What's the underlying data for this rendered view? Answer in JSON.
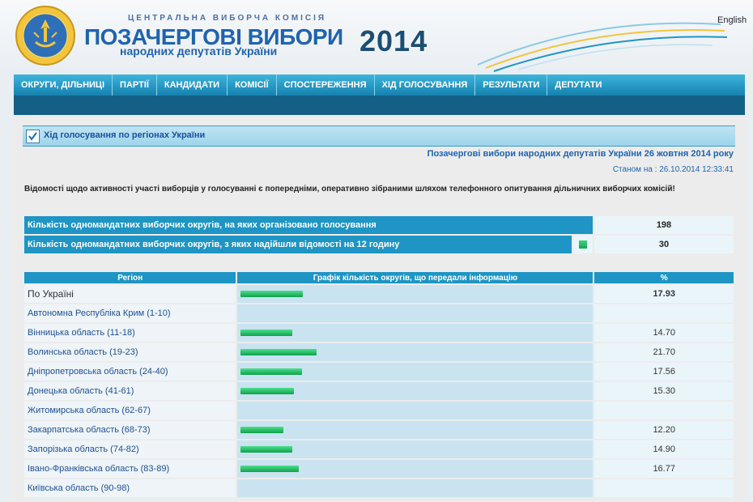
{
  "header": {
    "org": "ЦЕНТРАЛЬНА ВИБОРЧА КОМІСІЯ",
    "title_main": "ПОЗАЧЕРГОВІ ВИБОРИ",
    "title_sub": "народних депутатів України",
    "year": "2014",
    "lang_link": "English"
  },
  "nav": [
    "ОКРУГИ, ДІЛЬНИЦІ",
    "ПАРТІЇ",
    "КАНДИДАТИ",
    "КОМІСІЇ",
    "СПОСТЕРЕЖЕННЯ",
    "ХІД ГОЛОСУВАННЯ",
    "РЕЗУЛЬТАТИ",
    "ДЕПУТАТИ"
  ],
  "section": {
    "title": "Хід голосування по регіонах України",
    "election": "Позачергові вибори народних депутатів України 26 жовтня 2014 року",
    "as_of": "Станом на : 26.10.2014 12:33:41",
    "notice": "Відомості щодо активності участі виборців у голосуванні є попередніми, оперативно зібраними шляхом телефонного опитування дільничних виборчих комісій!"
  },
  "summary": [
    {
      "label": "Кількість одномандатних виборчих округів, на яких організовано голосування",
      "value": "198"
    },
    {
      "label": "Кількість одномандатних виборчих округів, з яких надійшли відомості на 12 годину",
      "value": "30"
    }
  ],
  "regions_table": {
    "headers": [
      "Регіон",
      "Графік кількість округів, що передали інформацію",
      "%"
    ],
    "bar_max_percent": 100,
    "rows": [
      {
        "name": "По Україні",
        "pct": "17.93",
        "value": 17.93
      },
      {
        "name": "Автономна Республіка Крим (1-10)",
        "pct": "",
        "value": null
      },
      {
        "name": "Вінницька область (11-18)",
        "pct": "14.70",
        "value": 14.7
      },
      {
        "name": "Волинська область (19-23)",
        "pct": "21.70",
        "value": 21.7
      },
      {
        "name": "Дніпропетровська область (24-40)",
        "pct": "17.56",
        "value": 17.56
      },
      {
        "name": "Донецька область (41-61)",
        "pct": "15.30",
        "value": 15.3
      },
      {
        "name": "Житомирська область (62-67)",
        "pct": "",
        "value": null
      },
      {
        "name": "Закарпатська область (68-73)",
        "pct": "12.20",
        "value": 12.2
      },
      {
        "name": "Запорізька область (74-82)",
        "pct": "14.90",
        "value": 14.9
      },
      {
        "name": "Івано-Франківська область (83-89)",
        "pct": "16.77",
        "value": 16.77
      },
      {
        "name": "Київська область (90-98)",
        "pct": "",
        "value": null
      }
    ]
  },
  "colors": {
    "nav_bg": "#2a9ec9",
    "subnav_bg": "#145f86",
    "bar": "#16a557",
    "title_blue": "#1e63b0"
  }
}
